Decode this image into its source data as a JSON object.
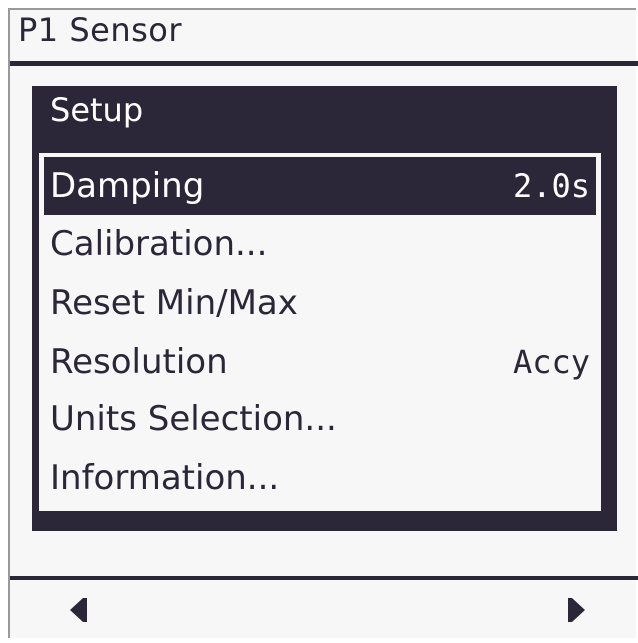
{
  "header": {
    "title": "P1 Sensor"
  },
  "setup": {
    "title": "Setup",
    "items": [
      {
        "label": "Damping",
        "value": "2.0s",
        "selected": true
      },
      {
        "label": "Calibration...",
        "value": ""
      },
      {
        "label": "Reset Min/Max",
        "value": ""
      },
      {
        "label": "Resolution",
        "value": "Accy"
      },
      {
        "label": "Units Selection...",
        "value": ""
      },
      {
        "label": "Information...",
        "value": ""
      }
    ]
  },
  "footer": {
    "left_icon": "triangle-left-icon",
    "right_icon": "triangle-right-icon"
  },
  "colors": {
    "foreground": "#2b2738",
    "background": "#f7f7f7",
    "highlight_text": "#ffffff"
  }
}
